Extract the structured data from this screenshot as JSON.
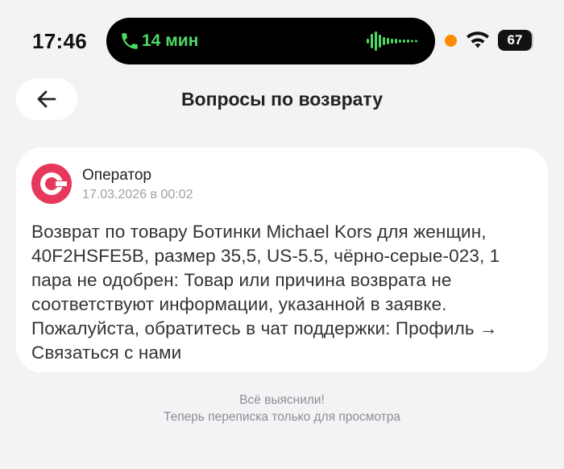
{
  "status_bar": {
    "time": "17:46",
    "call_duration": "14 мин",
    "battery": "67",
    "icons": [
      "phone-icon",
      "waveform-icon",
      "mic-indicator",
      "wifi-icon",
      "battery-icon"
    ],
    "colors": {
      "call_green": "#4cd964",
      "mic_orange": "#ff8a00"
    }
  },
  "header": {
    "back_icon": "arrow-left-icon",
    "title": "Вопросы по возврату"
  },
  "message": {
    "avatar_icon": "operator-logo-icon",
    "sender": "Оператор",
    "date": "17.03.2026 в 00:02",
    "text": "Возврат по товару Ботинки Michael Kors для женщин, 40F2HSFE5B, размер 35,5, US-5.5, чёрно-серые-023, 1 пара не одобрен: Товар или причина возврата не соответствуют информации, указанной в заявке. Пожалуйста, обратитесь в чат поддержки: Профиль → Связаться с нами",
    "colors": {
      "avatar": "#e6385c"
    }
  },
  "footer": {
    "line1": "Всё выяснили!",
    "line2": "Теперь переписка только для просмотра"
  }
}
